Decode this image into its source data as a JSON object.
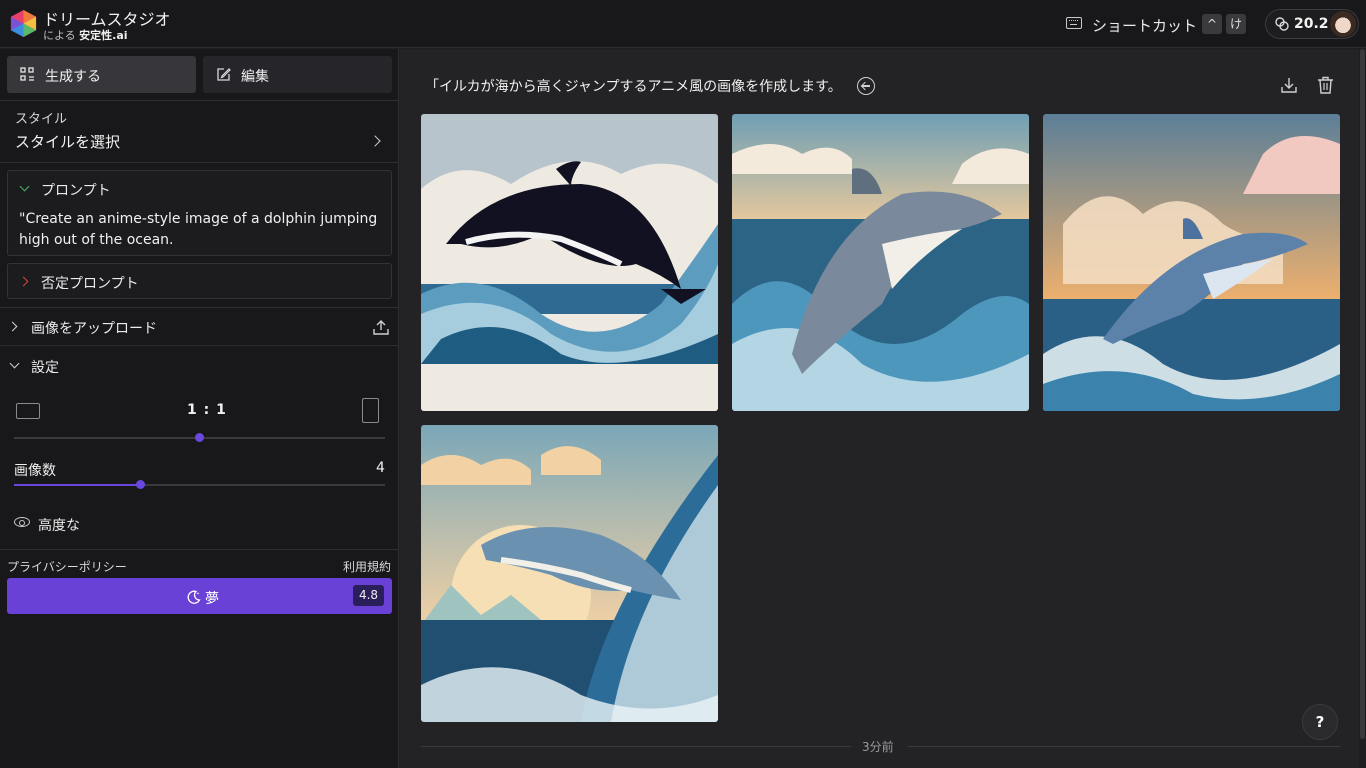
{
  "header": {
    "app_title": "ドリームスタジオ",
    "subtitle_prefix": "による",
    "subtitle_brand": "安定性.ai",
    "shortcut_label": "ショートカット",
    "shortcut_keys": [
      "^",
      "け"
    ],
    "credits": "20.2"
  },
  "sidebar": {
    "tabs": [
      {
        "label": "生成する",
        "icon": "grid-icon",
        "active": true
      },
      {
        "label": "編集",
        "icon": "edit-icon",
        "active": false
      }
    ],
    "style": {
      "label": "スタイル",
      "value": "スタイルを選択"
    },
    "prompt": {
      "title": "プロンプト",
      "text": "\"Create an anime-style image of a dolphin jumping high out of the ocean."
    },
    "negative_prompt": {
      "title": "否定プロンプト"
    },
    "upload": {
      "title": "画像をアップロード"
    },
    "settings": {
      "title": "設定",
      "aspect_ratio": "1 : 1",
      "aspect_ratio_position": 0.5,
      "image_count_label": "画像数",
      "image_count": "4",
      "image_count_position": 0.34,
      "advanced_label": "高度な"
    },
    "privacy_link": "プライバシーポリシー",
    "terms_link": "利用規約",
    "dream_button": {
      "label": "夢",
      "cost": "4.8"
    }
  },
  "main": {
    "prompt_heading": "「イルカが海から高くジャンプするアニメ風の画像を作成します。",
    "images": [
      {
        "name": "dolphin-image-1",
        "sky": "#b7c4cb"
      },
      {
        "name": "dolphin-image-2",
        "sky": "#e3c49a"
      },
      {
        "name": "dolphin-image-3",
        "sky": "#e8b07a"
      },
      {
        "name": "dolphin-image-4",
        "sky": "#e8cca0"
      }
    ],
    "timestamp": "3分前",
    "help_label": "?"
  },
  "colors": {
    "accent": "#6a41d6",
    "background": "#1f1f21",
    "sidebar": "#18181a"
  }
}
